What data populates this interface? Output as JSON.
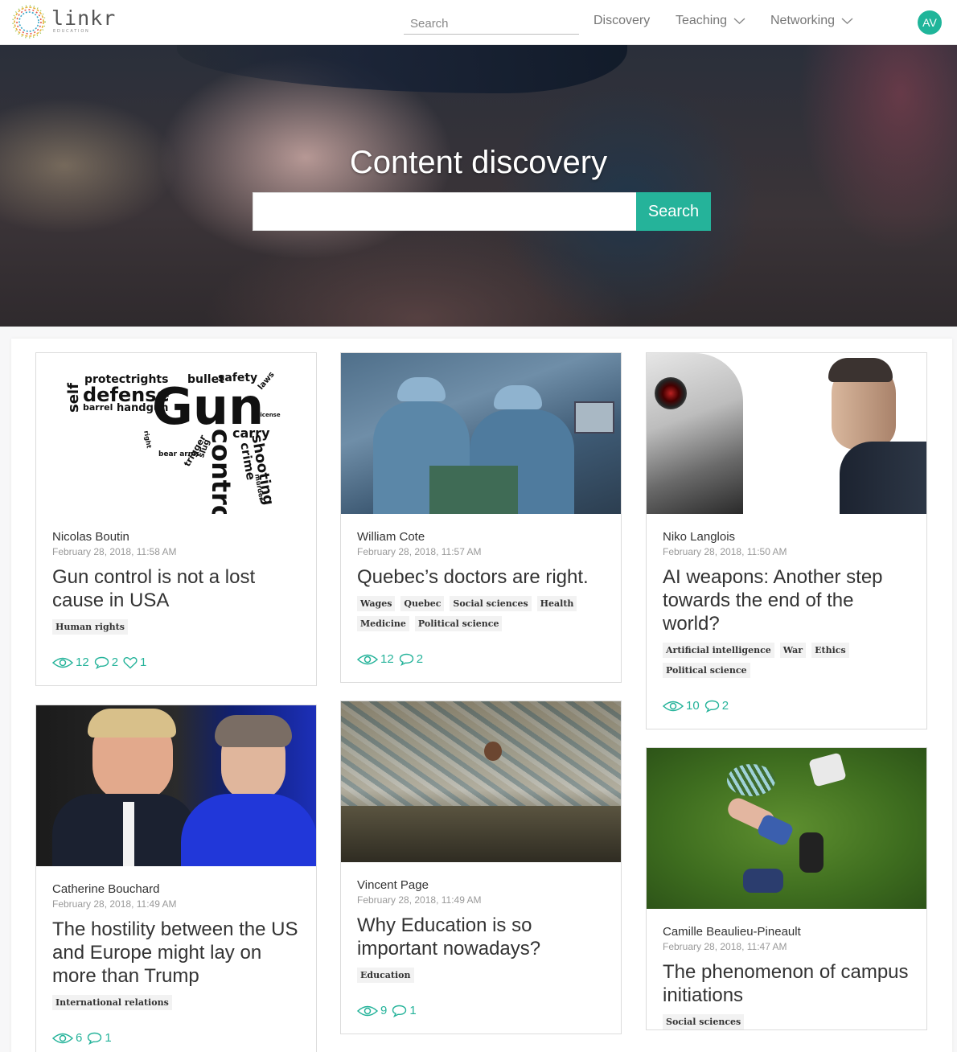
{
  "header": {
    "logo_text": "linkr",
    "logo_sub": "EDUCATION",
    "search_placeholder": "Search",
    "nav": [
      {
        "label": "Discovery"
      },
      {
        "label": "Teaching"
      },
      {
        "label": "Networking"
      }
    ],
    "avatar_initials": "AV"
  },
  "hero": {
    "title": "Content discovery",
    "search_value": "",
    "search_button": "Search"
  },
  "cards": [
    {
      "author": "Nicolas Boutin",
      "date": "February 28, 2018, 11:58 AM",
      "title": "Gun control is not a lost cause in USA",
      "tags": [
        "Human rights"
      ],
      "views": "12",
      "comments": "2",
      "likes": "1",
      "image_words": [
        "self",
        "protectrights",
        "defense",
        "barrel",
        "handgun",
        "bullet",
        "safety",
        "laws",
        "Gun",
        "license",
        "carry",
        "shooting",
        "crime",
        "control",
        "murder",
        "trigger",
        "slug",
        "bear arms",
        "right"
      ]
    },
    {
      "author": "William Cote",
      "date": "February 28, 2018, 11:57 AM",
      "title": "Quebec’s doctors are right.",
      "tags": [
        "Wages",
        "Quebec",
        "Social sciences",
        "Health",
        "Medicine",
        "Political science"
      ],
      "views": "12",
      "comments": "2"
    },
    {
      "author": "Niko Langlois",
      "date": "February 28, 2018, 11:50 AM",
      "title": "AI weapons: Another step towards the end of the world?",
      "tags": [
        "Artificial intelligence",
        "War",
        "Ethics",
        "Political science"
      ],
      "views": "10",
      "comments": "2"
    },
    {
      "author": "Catherine Bouchard",
      "date": "February 28, 2018, 11:49 AM",
      "title": "The hostility between the US and Europe might lay on more than Trump",
      "tags": [
        "International relations"
      ],
      "views": "6",
      "comments": "1"
    },
    {
      "author": "Vincent Page",
      "date": "February 28, 2018, 11:49 AM",
      "title": "Why Education is so important nowadays?",
      "tags": [
        "Education"
      ],
      "views": "9",
      "comments": "1"
    },
    {
      "author": "Camille Beaulieu-Pineault",
      "date": "February 28, 2018, 11:47 AM",
      "title": "The phenomenon of campus initiations",
      "tags": [
        "Social sciences"
      ]
    }
  ],
  "colors": {
    "accent": "#25b39a",
    "avatar": "#1fb59a",
    "tag_bg": "#f2f2f2"
  }
}
